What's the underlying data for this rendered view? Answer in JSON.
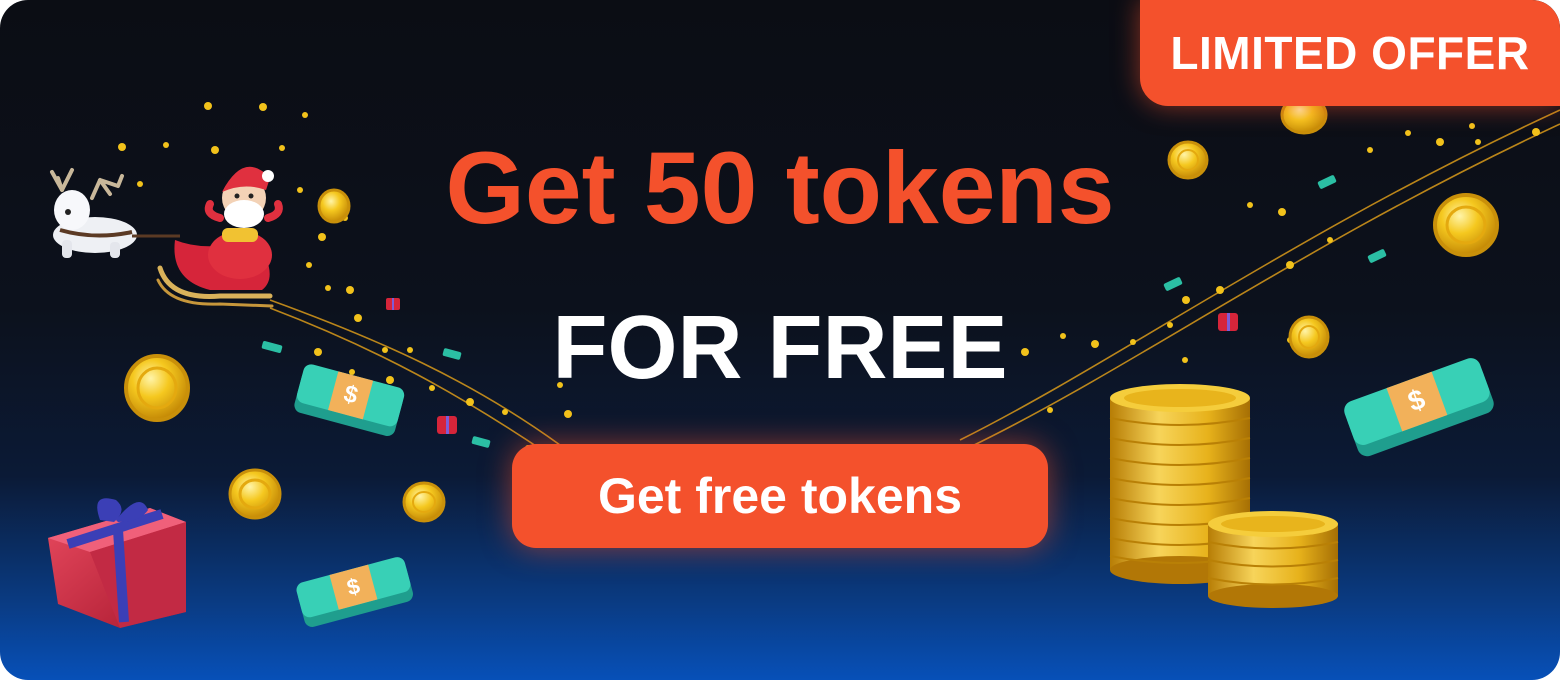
{
  "badge": {
    "label": "LIMITED OFFER"
  },
  "headline": "Get 50 tokens",
  "subhead": "FOR FREE",
  "cta": {
    "label": "Get free tokens"
  },
  "colors": {
    "accent": "#f4512c",
    "background_top": "#0b0d14",
    "background_bottom": "#0750b8",
    "coin": "#f2c21b",
    "text": "#ffffff"
  },
  "decorations": [
    "reindeer-icon",
    "santa-sleigh-icon",
    "gold-coin-icon",
    "cash-stack-icon",
    "gift-box-icon",
    "coin-stack-icon",
    "sparkle-dots"
  ]
}
